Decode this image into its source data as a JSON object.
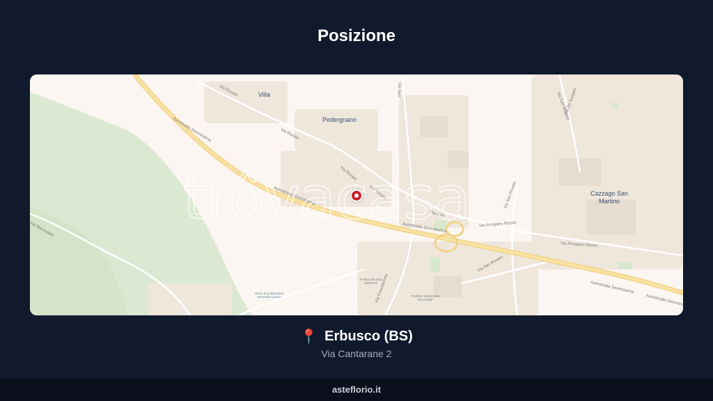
{
  "page": {
    "title": "Posizione"
  },
  "map": {
    "watermark": "trôvacasa",
    "places": {
      "villa": "Villa",
      "pedergnano": "Pedergnano",
      "cazzago": "Cazzago San Martino"
    },
    "roads": {
      "autostrada": "Autostrada Serenissima",
      "via_rovato": "Via Rovato",
      "via_iseo": "Via Iseo",
      "via_prospero_rizzini": "Via Prospero Rizzini",
      "via_san_rovato": "Via San Rovato",
      "via_franciacorta": "Via Franciacorta",
      "via_marmoleto": "Via Marmoleto",
      "via_san_michele": "Via San Michele",
      "via_de_gasperi": "Via De Gasperi"
    },
    "pois": {
      "parco_san_donato": "PARCO DI SAN DONATO",
      "parco_falcone": "PARCO \"GIOVANNI FALCONE\"",
      "vivaio": "Vivaio di Settemaloni Serenella Carera"
    },
    "colors": {
      "background": "#fbf6f1",
      "woodland": "#dbe9d2",
      "motorway": "#f6d98a",
      "marker": "#c6232e"
    }
  },
  "location": {
    "pin_icon": "map-pin-icon",
    "name": "Erbusco (BS)",
    "address": "Via Cantarane 2"
  },
  "footer": {
    "brand": "asteflorio.it"
  }
}
